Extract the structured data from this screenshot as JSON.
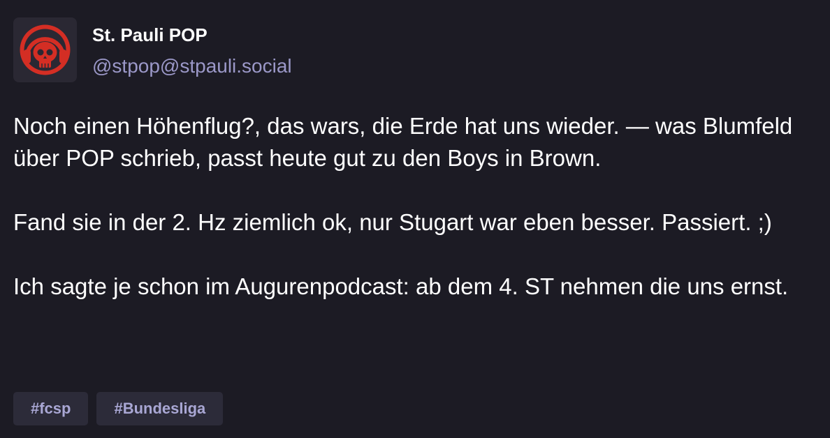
{
  "author": {
    "display_name": "St. Pauli POP",
    "handle": "@stpop@stpauli.social",
    "avatar_icon": "skull-headphones-logo"
  },
  "post": {
    "paragraphs": [
      "Noch einen Höhenflug?, das wars, die Erde hat uns wieder. — was Blumfeld über POP schrieb, passt heute gut zu den Boys in Brown.",
      "Fand sie in der 2. Hz ziemlich ok, nur Stugart war eben besser. Passiert. ;)",
      "Ich sagte je schon im Augurenpodcast: ab dem 4. ST nehmen die uns ernst."
    ]
  },
  "tags": [
    "#fcsp",
    "#Bundesliga"
  ],
  "colors": {
    "background": "#1c1b24",
    "handle": "#9b98c8",
    "tag_background": "#2c2b39",
    "tag_text": "#a9a7d4",
    "logo_red": "#d42e24"
  }
}
